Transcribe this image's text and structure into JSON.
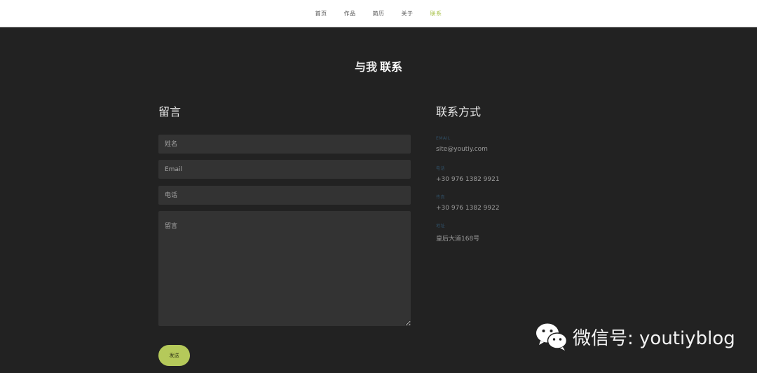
{
  "nav": {
    "items": [
      "首页",
      "作品",
      "简历",
      "关于",
      "联系"
    ],
    "active": "联系"
  },
  "section": {
    "title_light": "与我",
    "title_bold": "联系"
  },
  "form": {
    "heading": "留言",
    "name_placeholder": "姓名",
    "email_placeholder": "Email",
    "phone_placeholder": "电话",
    "message_placeholder": "留言",
    "send_label": "发送"
  },
  "contact": {
    "heading": "联系方式",
    "items": [
      {
        "label": "EMAIL",
        "value": "site@youtiy.com"
      },
      {
        "label": "电话",
        "value": "+30 976 1382 9921"
      },
      {
        "label": "传真",
        "value": "+30 976 1382 9922"
      },
      {
        "label": "地址",
        "value": "皇后大道168号"
      }
    ]
  },
  "watermark": {
    "icon": "wechat-icon",
    "text": "微信号: youtiyblog"
  },
  "colors": {
    "accent": "#b5c95a",
    "background": "#222222",
    "field": "#333333"
  }
}
